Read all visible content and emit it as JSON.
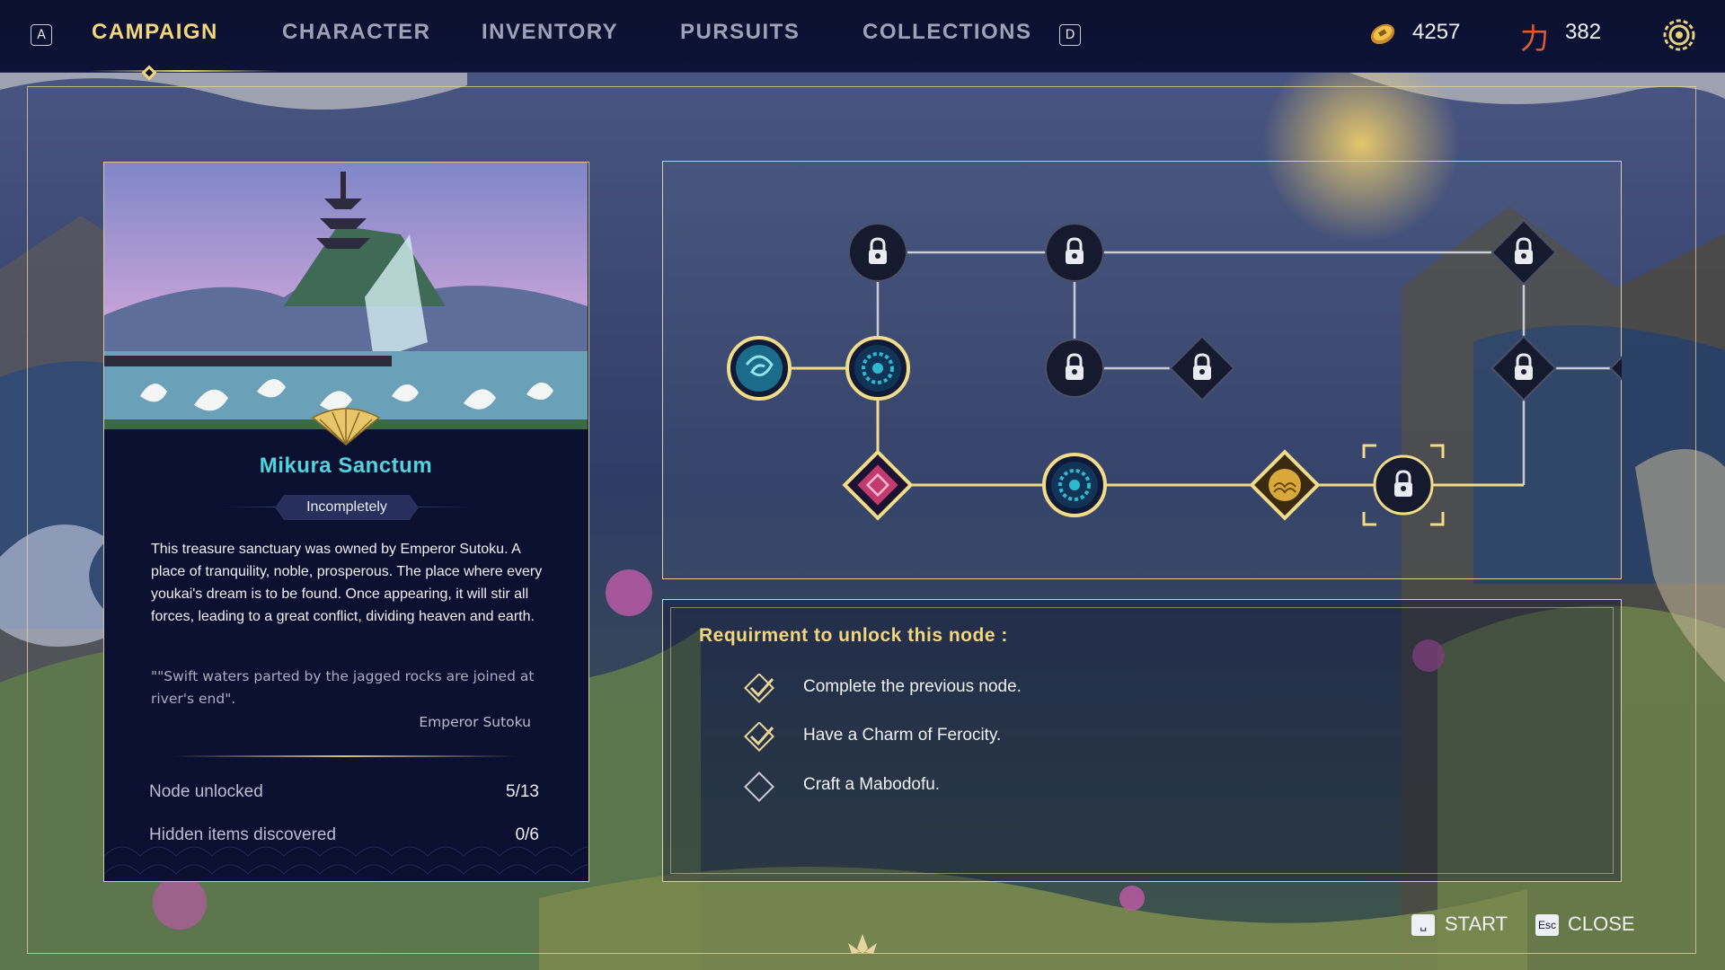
{
  "topbar": {
    "left_key": "A",
    "right_key": "D",
    "tabs": [
      {
        "label": "CAMPAIGN",
        "active": true
      },
      {
        "label": "CHARACTER",
        "active": false
      },
      {
        "label": "INVENTORY",
        "active": false
      },
      {
        "label": "PURSUITS",
        "active": false
      },
      {
        "label": "COLLECTIONS",
        "active": false
      }
    ],
    "currency_coin": "4257",
    "currency_power": "382",
    "power_glyph": "力",
    "colors": {
      "active_tab": "#f4d77c",
      "inactive_tab": "#9da2b6",
      "bar_bg": "#0b1030"
    }
  },
  "location": {
    "name": "Mikura Sanctum",
    "status": "Incompletely",
    "description": "This treasure sanctuary was owned by Emperor Sutoku. A place of tranquility, noble, prosperous. The place where every youkai's dream is to be found. Once appearing, it will stir all forces, leading to a great conflict, dividing heaven and earth.",
    "quote": "\"\"Swift waters parted by the jagged rocks are joined at river's end\".",
    "quote_author": "Emperor Sutoku",
    "stats": [
      {
        "label": "Node unlocked",
        "value": "5/13"
      },
      {
        "label": "Hidden items discovered",
        "value": "0/6"
      }
    ],
    "name_color": "#4fd4de"
  },
  "requirements": {
    "title": "Requirment to unlock this node :",
    "items": [
      {
        "text": "Complete the previous node.",
        "done": true
      },
      {
        "text": "Have a Charm of Ferocity.",
        "done": true
      },
      {
        "text": "Craft a Mabodofu.",
        "done": false
      }
    ]
  },
  "node_graph": {
    "nodes": [
      {
        "id": "n1",
        "shape": "circle",
        "state": "unlocked-swirl"
      },
      {
        "id": "n2",
        "shape": "circle",
        "state": "unlocked-mandala"
      },
      {
        "id": "n3",
        "shape": "diamond",
        "state": "unlocked-pink"
      },
      {
        "id": "n4",
        "shape": "circle",
        "state": "unlocked-mandala"
      },
      {
        "id": "n5",
        "shape": "diamond",
        "state": "unlocked-gold"
      },
      {
        "id": "n6",
        "shape": "circle",
        "state": "locked-selected"
      },
      {
        "id": "n7",
        "shape": "circle",
        "state": "locked"
      },
      {
        "id": "n8",
        "shape": "circle",
        "state": "locked"
      },
      {
        "id": "n9",
        "shape": "circle",
        "state": "locked"
      },
      {
        "id": "n10",
        "shape": "diamond",
        "state": "locked"
      },
      {
        "id": "n11",
        "shape": "diamond",
        "state": "locked"
      },
      {
        "id": "n12",
        "shape": "diamond",
        "state": "locked"
      },
      {
        "id": "n13",
        "shape": "diamond",
        "state": "locked"
      }
    ]
  },
  "footer": {
    "start_key": "␣",
    "start_label": "START",
    "close_key": "Esc",
    "close_label": "CLOSE"
  }
}
